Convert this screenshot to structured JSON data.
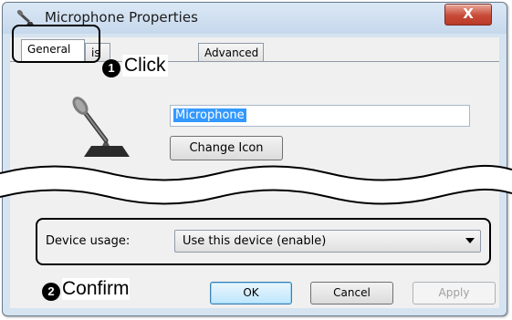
{
  "window": {
    "title": "Microphone Properties",
    "close_glyph": "X",
    "title_icon": "microphone-icon"
  },
  "tabs": [
    {
      "label": "General",
      "active": true
    },
    {
      "label": "is",
      "active": false
    },
    {
      "label": "Advanced",
      "active": false
    }
  ],
  "general": {
    "device_icon": "microphone-icon",
    "name_value": "Microphone",
    "change_icon_label": "Change Icon"
  },
  "device_usage": {
    "label": "Device usage:",
    "selected": "Use this device (enable)"
  },
  "buttons": {
    "ok": "OK",
    "cancel": "Cancel",
    "apply": "Apply"
  },
  "annotations": {
    "step1_marker": "1",
    "step1_label": "Click",
    "step2_marker": "2",
    "step2_label": "Confirm"
  },
  "colors": {
    "selection": "#3399ff",
    "close_button": "#c84a37",
    "callout": "#000000"
  }
}
